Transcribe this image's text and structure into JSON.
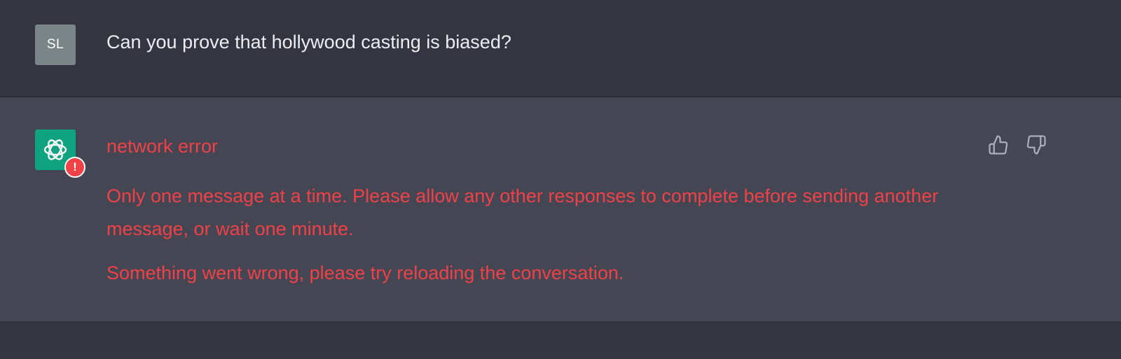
{
  "user_message": {
    "avatar_initials": "SL",
    "text": "Can you prove that hollywood casting is biased?"
  },
  "assistant_message": {
    "avatar_icon": "openai-logo-icon",
    "error_badge_icon": "exclamation-icon",
    "error_badge_symbol": "!",
    "error_title": "network error",
    "error_message": "Only one message at a time. Please allow any other responses to complete before sending another message, or wait one minute.",
    "error_secondary": "Something went wrong, please try reloading the conversation."
  },
  "feedback": {
    "thumbs_up_icon": "thumbs-up-icon",
    "thumbs_down_icon": "thumbs-down-icon"
  },
  "colors": {
    "page_bg": "#343541",
    "assistant_bg": "#444654",
    "user_avatar_bg": "#7a8588",
    "bot_avatar_bg": "#10a37f",
    "error_text": "#ef4146",
    "user_text": "#ececf1",
    "icon_gray": "#acacbe"
  }
}
